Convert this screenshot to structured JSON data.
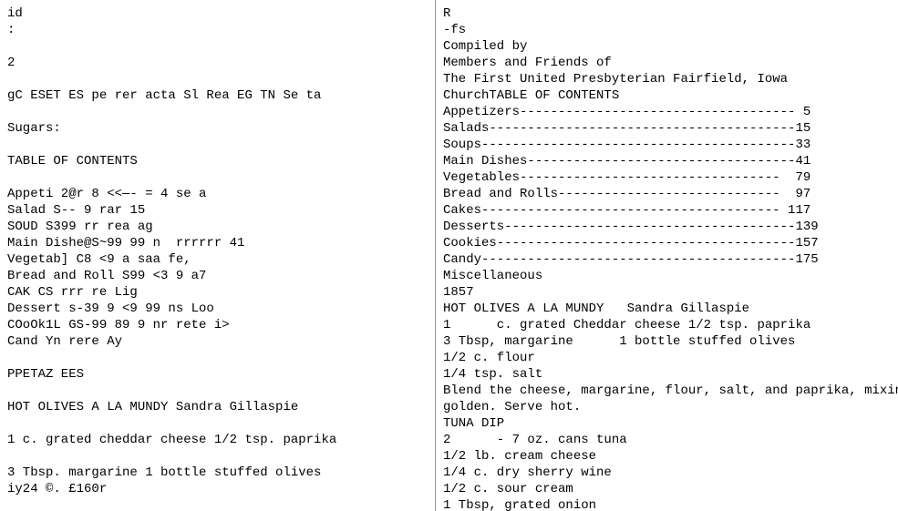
{
  "left": {
    "lines": [
      "id",
      ":",
      "",
      "2",
      "",
      "gC ESET ES pe rer acta Sl Rea EG TN Se ta",
      "",
      "Sugars:",
      "",
      "TABLE OF CONTENTS",
      "",
      "Appeti 2@r 8 <<—- = 4 se a",
      "Salad S-- 9 rar 15",
      "SOUD S399 rr rea ag",
      "Main Dishe@S~99 99 n  rrrrrr 41",
      "Vegetab] C8 <9 a saa fe,",
      "Bread and Roll S99 <3 9 a7",
      "CAK CS rrr re Lig",
      "Dessert s-39 9 <9 99 ns Loo",
      "COoOk1L GS-99 89 9 nr rete i>",
      "Cand Yn rere Ay",
      "",
      "PPETAZ EES",
      "",
      "HOT OLIVES A LA MUNDY Sandra Gillaspie",
      "",
      "1 c. grated cheddar cheese 1/2 tsp. paprika",
      "",
      "3 Tbsp. margarine 1 bottle stuffed olives",
      "iy24 ©. £160r"
    ]
  },
  "right": {
    "lines": [
      "R",
      "-fs",
      "Compiled by",
      "Members and Friends of",
      "The First United Presbyterian Fairfield, Iowa",
      "ChurchTABLE OF CONTENTS",
      "Appetizers------------------------------------ 5",
      "Salads----------------------------------------15",
      "Soups-----------------------------------------33",
      "Main Dishes-----------------------------------41",
      "Vegetables----------------------------------  79",
      "Bread and Rolls-----------------------------  97",
      "Cakes--------------------------------------- 117",
      "Desserts--------------------------------------139",
      "Cookies---------------------------------------157",
      "Candy-----------------------------------------175",
      "Miscellaneous",
      "1857",
      "HOT OLIVES A LA MUNDY   Sandra Gillaspie",
      "1      c. grated Cheddar cheese 1/2 tsp. paprika",
      "3 Tbsp, margarine      1 bottle stuffed olives",
      "1/2 c. flour",
      "1/4 tsp. salt",
      "Blend the cheese, margarine, flour, salt, and paprika, mixing",
      "golden. Serve hot.",
      "TUNA DIP",
      "2      - 7 oz. cans tuna",
      "1/2 lb. cream cheese",
      "1/4 c. dry sherry wine",
      "1/2 c. sour cream",
      "1 Tbsp, grated onion"
    ]
  }
}
